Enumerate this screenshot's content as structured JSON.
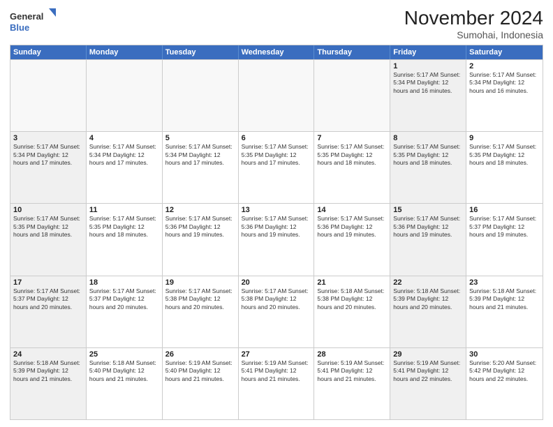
{
  "header": {
    "logo_line1": "General",
    "logo_line2": "Blue",
    "month": "November 2024",
    "location": "Sumohai, Indonesia"
  },
  "weekdays": [
    "Sunday",
    "Monday",
    "Tuesday",
    "Wednesday",
    "Thursday",
    "Friday",
    "Saturday"
  ],
  "rows": [
    [
      {
        "day": "",
        "info": "",
        "empty": true
      },
      {
        "day": "",
        "info": "",
        "empty": true
      },
      {
        "day": "",
        "info": "",
        "empty": true
      },
      {
        "day": "",
        "info": "",
        "empty": true
      },
      {
        "day": "",
        "info": "",
        "empty": true
      },
      {
        "day": "1",
        "info": "Sunrise: 5:17 AM\nSunset: 5:34 PM\nDaylight: 12 hours\nand 16 minutes.",
        "shaded": true
      },
      {
        "day": "2",
        "info": "Sunrise: 5:17 AM\nSunset: 5:34 PM\nDaylight: 12 hours\nand 16 minutes."
      }
    ],
    [
      {
        "day": "3",
        "info": "Sunrise: 5:17 AM\nSunset: 5:34 PM\nDaylight: 12 hours\nand 17 minutes.",
        "shaded": true
      },
      {
        "day": "4",
        "info": "Sunrise: 5:17 AM\nSunset: 5:34 PM\nDaylight: 12 hours\nand 17 minutes."
      },
      {
        "day": "5",
        "info": "Sunrise: 5:17 AM\nSunset: 5:34 PM\nDaylight: 12 hours\nand 17 minutes."
      },
      {
        "day": "6",
        "info": "Sunrise: 5:17 AM\nSunset: 5:35 PM\nDaylight: 12 hours\nand 17 minutes."
      },
      {
        "day": "7",
        "info": "Sunrise: 5:17 AM\nSunset: 5:35 PM\nDaylight: 12 hours\nand 18 minutes."
      },
      {
        "day": "8",
        "info": "Sunrise: 5:17 AM\nSunset: 5:35 PM\nDaylight: 12 hours\nand 18 minutes.",
        "shaded": true
      },
      {
        "day": "9",
        "info": "Sunrise: 5:17 AM\nSunset: 5:35 PM\nDaylight: 12 hours\nand 18 minutes."
      }
    ],
    [
      {
        "day": "10",
        "info": "Sunrise: 5:17 AM\nSunset: 5:35 PM\nDaylight: 12 hours\nand 18 minutes.",
        "shaded": true
      },
      {
        "day": "11",
        "info": "Sunrise: 5:17 AM\nSunset: 5:35 PM\nDaylight: 12 hours\nand 18 minutes."
      },
      {
        "day": "12",
        "info": "Sunrise: 5:17 AM\nSunset: 5:36 PM\nDaylight: 12 hours\nand 19 minutes."
      },
      {
        "day": "13",
        "info": "Sunrise: 5:17 AM\nSunset: 5:36 PM\nDaylight: 12 hours\nand 19 minutes."
      },
      {
        "day": "14",
        "info": "Sunrise: 5:17 AM\nSunset: 5:36 PM\nDaylight: 12 hours\nand 19 minutes."
      },
      {
        "day": "15",
        "info": "Sunrise: 5:17 AM\nSunset: 5:36 PM\nDaylight: 12 hours\nand 19 minutes.",
        "shaded": true
      },
      {
        "day": "16",
        "info": "Sunrise: 5:17 AM\nSunset: 5:37 PM\nDaylight: 12 hours\nand 19 minutes."
      }
    ],
    [
      {
        "day": "17",
        "info": "Sunrise: 5:17 AM\nSunset: 5:37 PM\nDaylight: 12 hours\nand 20 minutes.",
        "shaded": true
      },
      {
        "day": "18",
        "info": "Sunrise: 5:17 AM\nSunset: 5:37 PM\nDaylight: 12 hours\nand 20 minutes."
      },
      {
        "day": "19",
        "info": "Sunrise: 5:17 AM\nSunset: 5:38 PM\nDaylight: 12 hours\nand 20 minutes."
      },
      {
        "day": "20",
        "info": "Sunrise: 5:17 AM\nSunset: 5:38 PM\nDaylight: 12 hours\nand 20 minutes."
      },
      {
        "day": "21",
        "info": "Sunrise: 5:18 AM\nSunset: 5:38 PM\nDaylight: 12 hours\nand 20 minutes."
      },
      {
        "day": "22",
        "info": "Sunrise: 5:18 AM\nSunset: 5:39 PM\nDaylight: 12 hours\nand 20 minutes.",
        "shaded": true
      },
      {
        "day": "23",
        "info": "Sunrise: 5:18 AM\nSunset: 5:39 PM\nDaylight: 12 hours\nand 21 minutes."
      }
    ],
    [
      {
        "day": "24",
        "info": "Sunrise: 5:18 AM\nSunset: 5:39 PM\nDaylight: 12 hours\nand 21 minutes.",
        "shaded": true
      },
      {
        "day": "25",
        "info": "Sunrise: 5:18 AM\nSunset: 5:40 PM\nDaylight: 12 hours\nand 21 minutes."
      },
      {
        "day": "26",
        "info": "Sunrise: 5:19 AM\nSunset: 5:40 PM\nDaylight: 12 hours\nand 21 minutes."
      },
      {
        "day": "27",
        "info": "Sunrise: 5:19 AM\nSunset: 5:41 PM\nDaylight: 12 hours\nand 21 minutes."
      },
      {
        "day": "28",
        "info": "Sunrise: 5:19 AM\nSunset: 5:41 PM\nDaylight: 12 hours\nand 21 minutes."
      },
      {
        "day": "29",
        "info": "Sunrise: 5:19 AM\nSunset: 5:41 PM\nDaylight: 12 hours\nand 22 minutes.",
        "shaded": true
      },
      {
        "day": "30",
        "info": "Sunrise: 5:20 AM\nSunset: 5:42 PM\nDaylight: 12 hours\nand 22 minutes."
      }
    ]
  ]
}
